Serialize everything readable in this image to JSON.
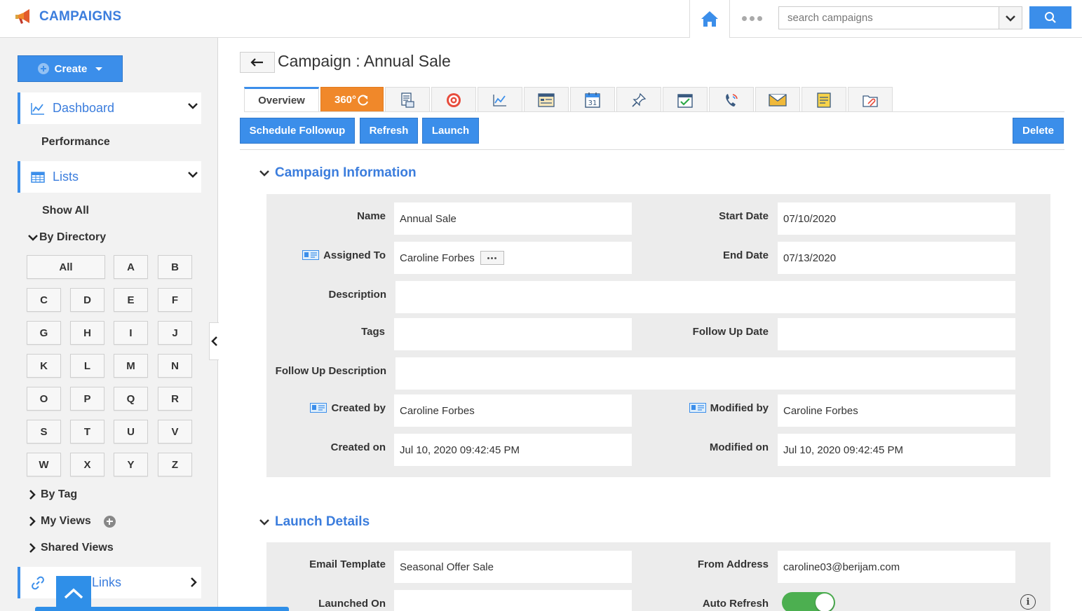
{
  "app": {
    "title": "CAMPAIGNS",
    "search_placeholder": "search campaigns"
  },
  "sidebar": {
    "create_label": "Create",
    "dashboard_label": "Dashboard",
    "performance_label": "Performance",
    "lists_label": "Lists",
    "show_all_label": "Show All",
    "by_directory_label": "By Directory",
    "letters": [
      "All",
      "A",
      "B",
      "C",
      "D",
      "E",
      "F",
      "G",
      "H",
      "I",
      "J",
      "K",
      "L",
      "M",
      "N",
      "O",
      "P",
      "Q",
      "R",
      "S",
      "T",
      "U",
      "V",
      "W",
      "X",
      "Y",
      "Z"
    ],
    "by_tag_label": "By Tag",
    "my_views_label": "My Views",
    "shared_views_label": "Shared Views",
    "links_label": "Links"
  },
  "page": {
    "title": "Campaign : Annual Sale",
    "tabs": [
      {
        "label": "Overview",
        "icon": "overview"
      },
      {
        "label": "360°",
        "icon": "refresh-icon"
      },
      {
        "label": "",
        "icon": "document-icon"
      },
      {
        "label": "",
        "icon": "target-icon"
      },
      {
        "label": "",
        "icon": "chart-icon"
      },
      {
        "label": "",
        "icon": "form-icon"
      },
      {
        "label": "",
        "icon": "calendar-icon"
      },
      {
        "label": "",
        "icon": "pin-icon"
      },
      {
        "label": "",
        "icon": "checklist-icon"
      },
      {
        "label": "",
        "icon": "phone-icon"
      },
      {
        "label": "",
        "icon": "mail-icon"
      },
      {
        "label": "",
        "icon": "note-icon"
      },
      {
        "label": "",
        "icon": "attachment-icon"
      }
    ],
    "calendar_day": "31",
    "actions": {
      "schedule_followup": "Schedule Followup",
      "refresh": "Refresh",
      "launch": "Launch",
      "delete": "Delete"
    }
  },
  "campaign_info": {
    "heading": "Campaign Information",
    "labels": {
      "name": "Name",
      "start_date": "Start Date",
      "assigned_to": "Assigned To",
      "end_date": "End Date",
      "description": "Description",
      "tags": "Tags",
      "follow_up_date": "Follow Up Date",
      "follow_up_description": "Follow Up Description",
      "created_by": "Created by",
      "modified_by": "Modified by",
      "created_on": "Created on",
      "modified_on": "Modified on"
    },
    "values": {
      "name": "Annual Sale",
      "start_date": "07/10/2020",
      "assigned_to": "Caroline Forbes",
      "end_date": "07/13/2020",
      "description": "",
      "tags": "",
      "follow_up_date": "",
      "follow_up_description": "",
      "created_by": "Caroline Forbes",
      "modified_by": "Caroline Forbes",
      "created_on": "Jul 10, 2020 09:42:45 PM",
      "modified_on": "Jul 10, 2020 09:42:45 PM"
    }
  },
  "launch_details": {
    "heading": "Launch Details",
    "labels": {
      "email_template": "Email Template",
      "from_address": "From Address",
      "launched_on": "Launched On",
      "auto_refresh": "Auto Refresh"
    },
    "values": {
      "email_template": "Seasonal Offer Sale",
      "from_address": "caroline03@berijam.com",
      "launched_on": "",
      "auto_refresh": true
    }
  },
  "colors": {
    "accent": "#3b8eea",
    "tab_360": "#f0882a",
    "toggle_on": "#4caf50"
  }
}
